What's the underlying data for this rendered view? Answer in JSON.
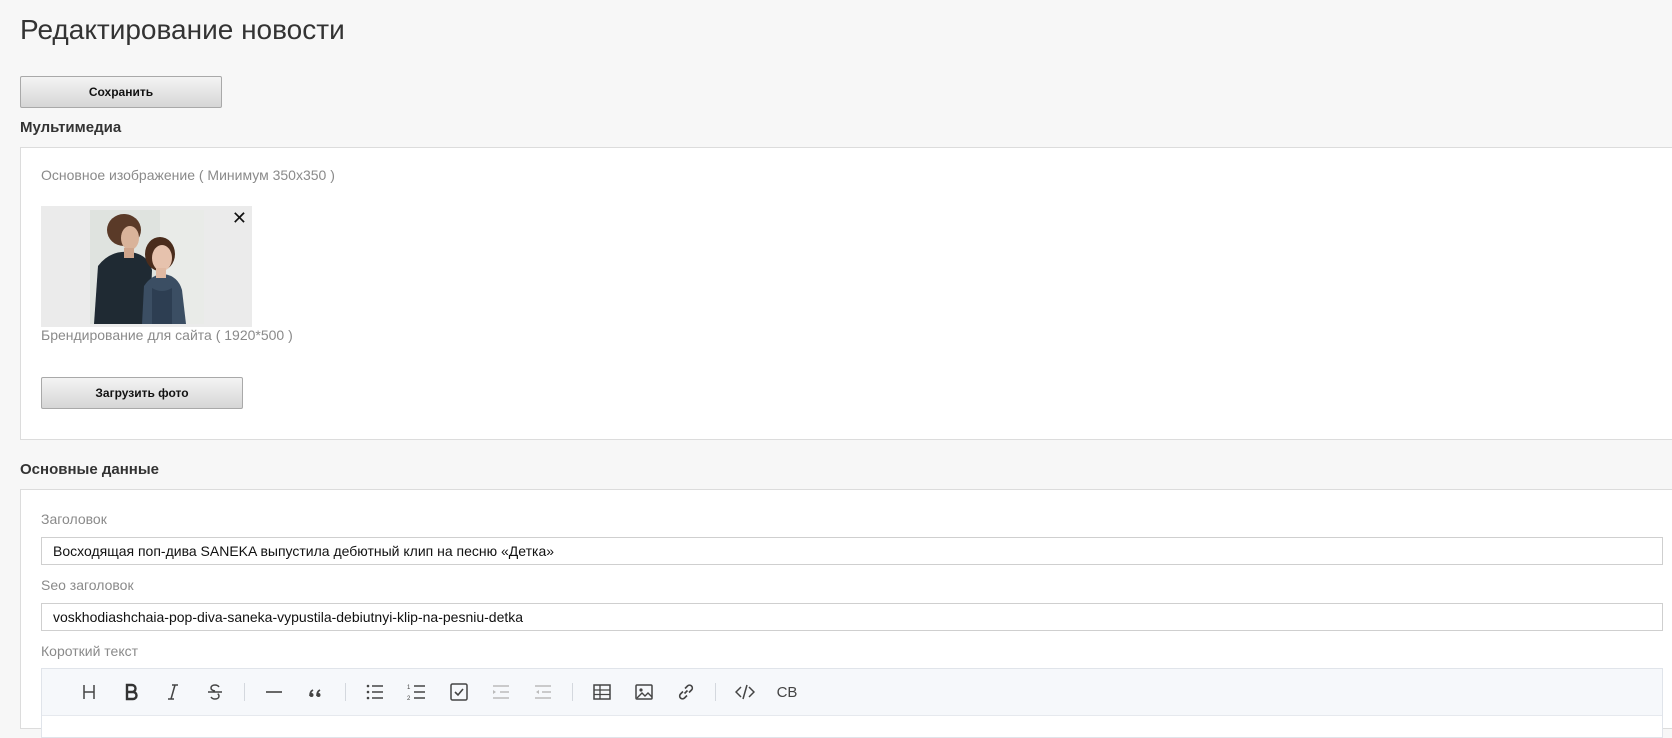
{
  "page": {
    "title": "Редактирование новости",
    "save_label": "Сохранить"
  },
  "multimedia": {
    "heading": "Мультимедиа",
    "main_image_label": "Основное изображение ( Минимум 350x350 )",
    "remove_symbol": "✕",
    "branding_label": "Брендирование для сайта ( 1920*500 )",
    "upload_label": "Загрузить фото"
  },
  "main_data": {
    "heading": "Основные данные",
    "title_label": "Заголовок",
    "title_value": "Восходящая поп-дива SANEKA выпустила дебютный клип на песню «Детка»",
    "seo_label": "Seo заголовок",
    "seo_value": "voskhodiashchaia-pop-diva-saneka-vypustila-debiutnyi-klip-na-pesniu-detka",
    "short_text_label": "Короткий текст"
  },
  "editor": {
    "toolbar": [
      {
        "icon": "heading-icon"
      },
      {
        "icon": "bold-icon"
      },
      {
        "icon": "italic-icon"
      },
      {
        "icon": "strikethrough-icon"
      },
      {
        "icon": "horizontal-rule-icon"
      },
      {
        "icon": "quote-icon"
      },
      {
        "icon": "bullet-list-icon"
      },
      {
        "icon": "numbered-list-icon"
      },
      {
        "icon": "task-list-icon"
      },
      {
        "icon": "indent-icon"
      },
      {
        "icon": "outdent-icon"
      },
      {
        "icon": "table-icon"
      },
      {
        "icon": "image-icon"
      },
      {
        "icon": "link-icon"
      },
      {
        "icon": "code-icon"
      },
      {
        "icon": "custom-block",
        "label": "CB"
      }
    ]
  },
  "colors": {
    "background": "#f7f7f7",
    "panel": "#ffffff",
    "label_gray": "#8a8a8a",
    "toolbar_bg": "#f6f8fb"
  }
}
